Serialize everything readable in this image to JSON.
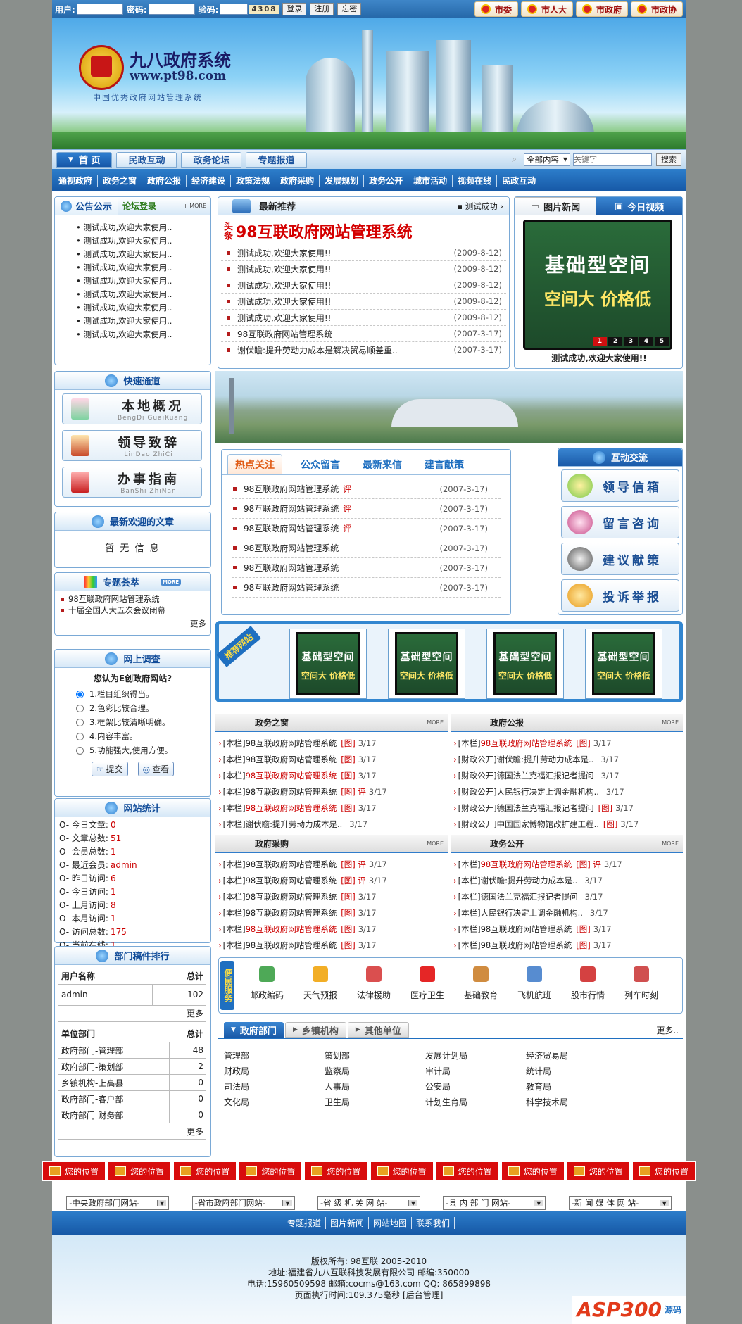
{
  "topbar": {
    "user_label": "用户:",
    "pass_label": "密码:",
    "code_label": "验码:",
    "captcha": "4308",
    "login": "登录",
    "register": "注册",
    "forgot": "忘密",
    "links": [
      "市委",
      "市人大",
      "市政府",
      "市政协"
    ]
  },
  "banner": {
    "title": "九八政府系统",
    "url": "www.pt98.com",
    "subtitle": "中国优秀政府网站管理系统"
  },
  "nav1": {
    "tabs": [
      "首 页",
      "民政互动",
      "政务论坛",
      "专题报道"
    ],
    "search_scope": "全部内容",
    "search_placeholder": "关键字",
    "search_button": "搜索"
  },
  "nav2": [
    "通视政府",
    "政务之窗",
    "政府公报",
    "经济建设",
    "政策法规",
    "政府采购",
    "发展规划",
    "政务公开",
    "城市活动",
    "视频在线",
    "民政互动"
  ],
  "notice": {
    "tab_active": "公告公示",
    "tab_other": "论坛登录",
    "more": "MORE",
    "items": [
      "测试成功,欢迎大家使用..",
      "测试成功,欢迎大家使用..",
      "测试成功,欢迎大家使用..",
      "测试成功,欢迎大家使用..",
      "测试成功,欢迎大家使用..",
      "测试成功,欢迎大家使用..",
      "测试成功,欢迎大家使用..",
      "测试成功,欢迎大家使用..",
      "测试成功,欢迎大家使用.."
    ]
  },
  "quick": {
    "title": "快速通道",
    "items": [
      {
        "label": "本地概况",
        "pinyin": "BengDi GuaiKuang"
      },
      {
        "label": "领导致辞",
        "pinyin": "LinDao ZhiCi"
      },
      {
        "label": "办事指南",
        "pinyin": "BanShi ZhiNan"
      }
    ]
  },
  "popular": {
    "title": "最新欢迎的文章",
    "empty": "暂 无 信 息"
  },
  "topics": {
    "title": "专题荟萃",
    "more_badge": "MORE",
    "items": [
      "98互联政府网站管理系统",
      "十届全国人大五次会议闭幕"
    ],
    "more": "更多"
  },
  "survey": {
    "title": "网上调查",
    "question": "您认为E创政府网站?",
    "options": [
      "1.栏目组织得当。",
      "2.色彩比较合理。",
      "3.框架比较清晰明确。",
      "4.内容丰富。",
      "5.功能强大,使用方便。"
    ],
    "submit": "提交",
    "view": "查看"
  },
  "stats": {
    "title": "网站统计",
    "rows": [
      {
        "label": "O- 今日文章:",
        "value": "0"
      },
      {
        "label": "O- 文章总数:",
        "value": "51"
      },
      {
        "label": "O- 会员总数:",
        "value": "1"
      },
      {
        "label": "O- 最近会员:",
        "value": "admin"
      },
      {
        "label": "O- 昨日访问:",
        "value": "6"
      },
      {
        "label": "O- 今日访问:",
        "value": "1"
      },
      {
        "label": "O- 上月访问:",
        "value": "8"
      },
      {
        "label": "O- 本月访问:",
        "value": "1"
      },
      {
        "label": "O- 访问总数:",
        "value": "175"
      },
      {
        "label": "O- 当前在线:",
        "value": "1"
      }
    ]
  },
  "ranking": {
    "title": "部门稿件排行",
    "user_header": [
      "用户名称",
      "总计"
    ],
    "users": [
      {
        "name": "admin",
        "count": "102"
      }
    ],
    "more1": "更多",
    "unit_header": [
      "单位部门",
      "总计"
    ],
    "units": [
      {
        "name": "政府部门-管理部",
        "count": "48"
      },
      {
        "name": "政府部门-策划部",
        "count": "2"
      },
      {
        "name": "乡镇机构-上高县",
        "count": "0"
      },
      {
        "name": "政府部门-客户部",
        "count": "0"
      },
      {
        "name": "政府部门-财务部",
        "count": "0"
      }
    ],
    "more2": "更多"
  },
  "recommend": {
    "title": "最新推荐",
    "right_link": "测试成功",
    "headline_tag": "头条",
    "headline": "98互联政府网站管理系统",
    "items": [
      {
        "text": "测试成功,欢迎大家使用!!",
        "date": "(2009-8-12)"
      },
      {
        "text": "测试成功,欢迎大家使用!!",
        "date": "(2009-8-12)"
      },
      {
        "text": "测试成功,欢迎大家使用!!",
        "date": "(2009-8-12)"
      },
      {
        "text": "测试成功,欢迎大家使用!!",
        "date": "(2009-8-12)"
      },
      {
        "text": "测试成功,欢迎大家使用!!",
        "date": "(2009-8-12)"
      },
      {
        "text": "98互联政府网站管理系统",
        "date": "(2007-3-17)"
      },
      {
        "text": "谢伏瞻:提升劳动力成本是解决贸易顺差重..",
        "date": "(2007-3-17)"
      }
    ]
  },
  "photo_news": {
    "tab_active": "图片新闻",
    "tab_other": "今日视频",
    "ad_line1": "基础型空间",
    "ad_line2": "空间大 价格低",
    "pages": [
      "1",
      "2",
      "3",
      "4",
      "5"
    ],
    "caption": "测试成功,欢迎大家使用!!"
  },
  "hot": {
    "tabs": [
      "热点关注",
      "公众留言",
      "最新来信",
      "建言献策"
    ],
    "items": [
      {
        "text": "98互联政府网站管理系统",
        "tag": "评",
        "date": "(2007-3-17)"
      },
      {
        "text": "98互联政府网站管理系统",
        "tag": "评",
        "date": "(2007-3-17)"
      },
      {
        "text": "98互联政府网站管理系统",
        "tag": "评",
        "date": "(2007-3-17)"
      },
      {
        "text": "98互联政府网站管理系统",
        "tag": "",
        "date": "(2007-3-17)"
      },
      {
        "text": "98互联政府网站管理系统",
        "tag": "",
        "date": "(2007-3-17)"
      },
      {
        "text": "98互联政府网站管理系统",
        "tag": "",
        "date": "(2007-3-17)"
      }
    ]
  },
  "interact": {
    "title": "互动交流",
    "buttons": [
      "领导信箱",
      "留言咨询",
      "建议献策",
      "投诉举报"
    ]
  },
  "recommend_strip": {
    "label": "推荐网站",
    "ads": [
      {
        "l1": "基础型空间",
        "l2": "空间大 价格低"
      },
      {
        "l1": "基础型空间",
        "l2": "空间大 价格低"
      },
      {
        "l1": "基础型空间",
        "l2": "空间大 价格低"
      },
      {
        "l1": "基础型空间",
        "l2": "空间大 价格低"
      }
    ]
  },
  "columns": [
    {
      "title": "政务之窗",
      "more": "MORE",
      "items": [
        {
          "cat": "[本栏]",
          "text": "98互联政府网站管理系统",
          "red": false,
          "tags": "[图]",
          "date": "3/17"
        },
        {
          "cat": "[本栏]",
          "text": "98互联政府网站管理系统",
          "red": false,
          "tags": "[图]",
          "date": "3/17"
        },
        {
          "cat": "[本栏]",
          "text": "98互联政府网站管理系统",
          "red": true,
          "tags": "[图]",
          "date": "3/17"
        },
        {
          "cat": "[本栏]",
          "text": "98互联政府网站管理系统",
          "red": false,
          "tags": "[图] 评",
          "date": "3/17"
        },
        {
          "cat": "[本栏]",
          "text": "98互联政府网站管理系统",
          "red": true,
          "tags": "[图]",
          "date": "3/17"
        },
        {
          "cat": "[本栏]",
          "text": "谢伏瞻:提升劳动力成本是..",
          "red": false,
          "tags": "",
          "date": "3/17"
        }
      ]
    },
    {
      "title": "政府公报",
      "more": "MORE",
      "items": [
        {
          "cat": "[本栏]",
          "text": "98互联政府网站管理系统",
          "red": true,
          "tags": "[图]",
          "date": "3/17"
        },
        {
          "cat": "[财政公开]",
          "text": "谢伏瞻:提升劳动力成本是..",
          "red": false,
          "tags": "",
          "date": "3/17"
        },
        {
          "cat": "[财政公开]",
          "text": "德国法兰克福汇报记者提问",
          "red": false,
          "tags": "",
          "date": "3/17"
        },
        {
          "cat": "[财政公开]",
          "text": "人民银行决定上调金融机构..",
          "red": false,
          "tags": "",
          "date": "3/17"
        },
        {
          "cat": "[财政公开]",
          "text": "德国法兰克福汇报记者提问",
          "red": false,
          "tags": "[图]",
          "date": "3/17"
        },
        {
          "cat": "[财政公开]",
          "text": "中国国家博物馆改扩建工程..",
          "red": false,
          "tags": "[图]",
          "date": "3/17"
        }
      ]
    },
    {
      "title": "政府采购",
      "more": "MORE",
      "items": [
        {
          "cat": "[本栏]",
          "text": "98互联政府网站管理系统",
          "red": false,
          "tags": "[图] 评",
          "date": "3/17"
        },
        {
          "cat": "[本栏]",
          "text": "98互联政府网站管理系统",
          "red": false,
          "tags": "[图] 评",
          "date": "3/17"
        },
        {
          "cat": "[本栏]",
          "text": "98互联政府网站管理系统",
          "red": false,
          "tags": "[图]",
          "date": "3/17"
        },
        {
          "cat": "[本栏]",
          "text": "98互联政府网站管理系统",
          "red": false,
          "tags": "[图]",
          "date": "3/17"
        },
        {
          "cat": "[本栏]",
          "text": "98互联政府网站管理系统",
          "red": true,
          "tags": "[图]",
          "date": "3/17"
        },
        {
          "cat": "[本栏]",
          "text": "98互联政府网站管理系统",
          "red": false,
          "tags": "[图]",
          "date": "3/17"
        }
      ]
    },
    {
      "title": "政务公开",
      "more": "MORE",
      "items": [
        {
          "cat": "[本栏]",
          "text": "98互联政府网站管理系统",
          "red": true,
          "tags": "[图] 评",
          "date": "3/17"
        },
        {
          "cat": "[本栏]",
          "text": "谢伏瞻:提升劳动力成本是..",
          "red": false,
          "tags": "",
          "date": "3/17"
        },
        {
          "cat": "[本栏]",
          "text": "德国法兰克福汇报记者提问",
          "red": false,
          "tags": "",
          "date": "3/17"
        },
        {
          "cat": "[本栏]",
          "text": "人民银行决定上调金融机构..",
          "red": false,
          "tags": "",
          "date": "3/17"
        },
        {
          "cat": "[本栏]",
          "text": "98互联政府网站管理系统",
          "red": false,
          "tags": "[图]",
          "date": "3/17"
        },
        {
          "cat": "[本栏]",
          "text": "98互联政府网站管理系统",
          "red": false,
          "tags": "[图]",
          "date": "3/17"
        }
      ]
    }
  ],
  "services": {
    "label": "便民服务",
    "items": [
      {
        "label": "邮政编码",
        "color": "#2f9a3a"
      },
      {
        "label": "天气预报",
        "color": "#f0a000"
      },
      {
        "label": "法律援助",
        "color": "#d43030"
      },
      {
        "label": "医疗卫生",
        "color": "#e00000"
      },
      {
        "label": "基础教育",
        "color": "#c8781e"
      },
      {
        "label": "飞机航班",
        "color": "#3a78c8"
      },
      {
        "label": "股市行情",
        "color": "#cc2020"
      },
      {
        "label": "列车时刻",
        "color": "#c83030"
      }
    ]
  },
  "directory": {
    "tabs": [
      "政府部门",
      "乡镇机构",
      "其他单位"
    ],
    "more": "更多..",
    "rows": [
      [
        "管理部",
        "策划部",
        "发展计划局",
        "经济贸易局"
      ],
      [
        "财政局",
        "监察局",
        "审计局",
        "统计局"
      ],
      [
        "司法局",
        "人事局",
        "公安局",
        "教育局"
      ],
      [
        "文化局",
        "卫生局",
        "计划生育局",
        "科学技术局"
      ]
    ]
  },
  "bottom_ads": [
    "您的位置",
    "您的位置",
    "您的位置",
    "您的位置",
    "您的位置",
    "您的位置",
    "您的位置",
    "您的位置",
    "您的位置",
    "您的位置"
  ],
  "link_selects": [
    "-中央政府部门网站-",
    "-省市政府部门网站-",
    "-省 级 机 关 网 站-",
    "-县 内 部 门 网站-",
    "-新 闻 媒 体 网 站-"
  ],
  "footer_nav": [
    "专题报道",
    "图片新闻",
    "网站地图",
    "联系我们"
  ],
  "footer": {
    "line1": "版权所有: 98互联 2005-2010",
    "line2": "地址:福建省九八互联科技发展有限公司 邮编:350000",
    "line3": "电话:15960509598 邮箱:cocms@163.com QQ: 865899898",
    "line4": "页面执行时间:109.375毫秒 [后台管理]",
    "watermark": "ASP300",
    "watermark_suffix": "源码"
  },
  "colors": {
    "primary_blue": "#1f6fc0",
    "accent_red": "#cc0000"
  }
}
